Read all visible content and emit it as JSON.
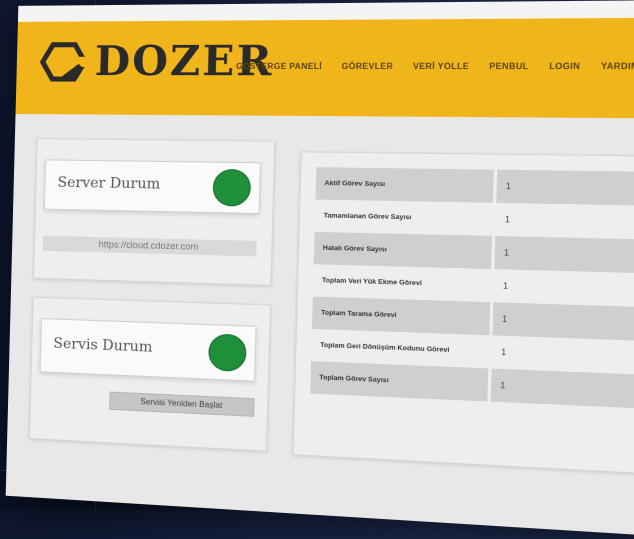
{
  "app": {
    "name": "DOZER"
  },
  "nav": {
    "items": [
      "GÖSTERGE PANELİ",
      "GÖREVLER",
      "VERİ YOLLE",
      "PENBUL",
      "LOGIN",
      "YARDIM"
    ]
  },
  "server_card": {
    "title": "Server Durum",
    "status_color": "#1f8f3a",
    "url": "https://cloud.cdozer.com"
  },
  "service_card": {
    "title": "Servis Durum",
    "status_color": "#1f8f3a",
    "restart_button": "Servisi Yeniden Başlat"
  },
  "stats": [
    {
      "label": "Aktif Görev Sayısı",
      "value": "1"
    },
    {
      "label": "Tamamlanan Görev Sayısı",
      "value": "1"
    },
    {
      "label": "Hatalı Görev Sayısı",
      "value": "1"
    },
    {
      "label": "Toplam Veri Yük Ekme Görevi",
      "value": "1"
    },
    {
      "label": "Toplam Tarama Görevi",
      "value": "1"
    },
    {
      "label": "Toplam Geri Dönüşüm Kodunu Görevi",
      "value": "1"
    },
    {
      "label": "Toplam Görev Sayısı",
      "value": "1"
    }
  ],
  "colors": {
    "accent": "#f1b51c",
    "status_ok": "#1f8f3a",
    "background": "#101a36"
  }
}
